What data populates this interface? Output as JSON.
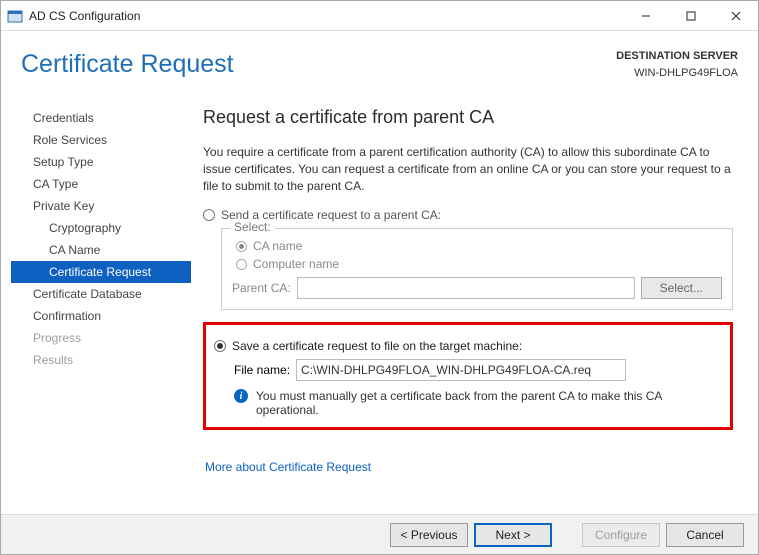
{
  "window": {
    "title": "AD CS Configuration"
  },
  "header": {
    "heading": "Certificate Request",
    "destLabel": "DESTINATION SERVER",
    "destValue": "WIN-DHLPG49FLOA"
  },
  "sidebar": {
    "items": [
      {
        "label": "Credentials",
        "level": 1
      },
      {
        "label": "Role Services",
        "level": 1
      },
      {
        "label": "Setup Type",
        "level": 1
      },
      {
        "label": "CA Type",
        "level": 1
      },
      {
        "label": "Private Key",
        "level": 1
      },
      {
        "label": "Cryptography",
        "level": 2
      },
      {
        "label": "CA Name",
        "level": 2
      },
      {
        "label": "Certificate Request",
        "level": 2,
        "selected": true
      },
      {
        "label": "Certificate Database",
        "level": 1
      },
      {
        "label": "Confirmation",
        "level": 1
      },
      {
        "label": "Progress",
        "level": 1,
        "dim": true
      },
      {
        "label": "Results",
        "level": 1,
        "dim": true
      }
    ]
  },
  "main": {
    "title": "Request a certificate from parent CA",
    "description": "You require a certificate from a parent certification authority (CA) to allow this subordinate CA to issue certificates. You can request a certificate from an online CA or you can store your request to a file to submit to the parent CA.",
    "option1": {
      "label": "Send a certificate request to a parent CA:",
      "groupLegend": "Select:",
      "subCAName": "CA name",
      "subComputerName": "Computer name",
      "parentCALabel": "Parent CA:",
      "parentCAValue": "",
      "selectBtn": "Select..."
    },
    "option2": {
      "label": "Save a certificate request to file on the target machine:",
      "fileLabel": "File name:",
      "fileValue": "C:\\WIN-DHLPG49FLOA_WIN-DHLPG49FLOA-CA.req",
      "infoText": "You must manually get a certificate back from the parent CA to make this CA operational."
    },
    "moreLink": "More about Certificate Request"
  },
  "footer": {
    "prev": "< Previous",
    "next": "Next >",
    "configure": "Configure",
    "cancel": "Cancel"
  }
}
